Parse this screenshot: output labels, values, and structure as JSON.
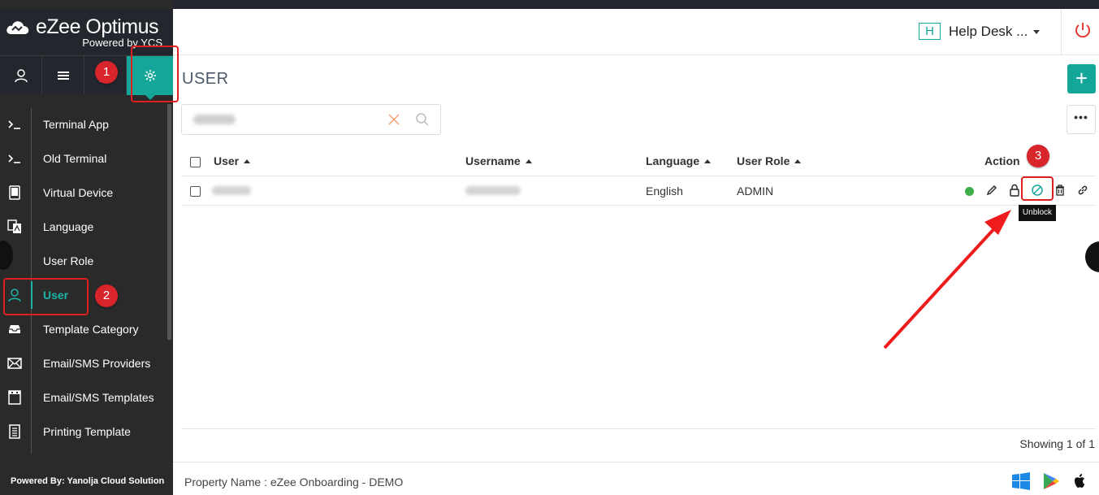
{
  "sidebar": {
    "brand_name": "eZee Optimus",
    "brand_sub": "Powered by YCS",
    "footer": "Powered By: Yanolja Cloud Solution",
    "items": [
      {
        "label": "Terminal App",
        "icon": "terminal-icon"
      },
      {
        "label": "Old Terminal",
        "icon": "terminal-icon"
      },
      {
        "label": "Virtual Device",
        "icon": "tablet-icon"
      },
      {
        "label": "Language",
        "icon": "translate-icon"
      },
      {
        "label": "User Role",
        "icon": "user-role-icon"
      },
      {
        "label": "User",
        "icon": "user-icon",
        "active": true
      },
      {
        "label": "Template Category",
        "icon": "inbox-icon"
      },
      {
        "label": "Email/SMS Providers",
        "icon": "envelope-icon"
      },
      {
        "label": "Email/SMS Templates",
        "icon": "film-icon"
      },
      {
        "label": "Printing Template",
        "icon": "receipt-icon"
      }
    ]
  },
  "header": {
    "property_initial": "H",
    "property_name": "Help Desk ..."
  },
  "page": {
    "title": "USER",
    "add_label": "+",
    "more_label": "•••"
  },
  "table": {
    "columns": {
      "user": "User",
      "username": "Username",
      "language": "Language",
      "user_role": "User Role",
      "action": "Action"
    },
    "rows": [
      {
        "language": "English",
        "user_role": "ADMIN",
        "status": "active"
      }
    ],
    "tooltip": "Unblock",
    "showing": "Showing 1 of 1"
  },
  "footer": {
    "property": "Property Name : eZee Onboarding - DEMO"
  },
  "annotations": {
    "step1": "1",
    "step2": "2",
    "step3": "3"
  },
  "colors": {
    "accent": "#14a799",
    "sidebar_bg": "#2a2a2a",
    "highlight": "#e02020",
    "status_active": "#3dae48"
  }
}
